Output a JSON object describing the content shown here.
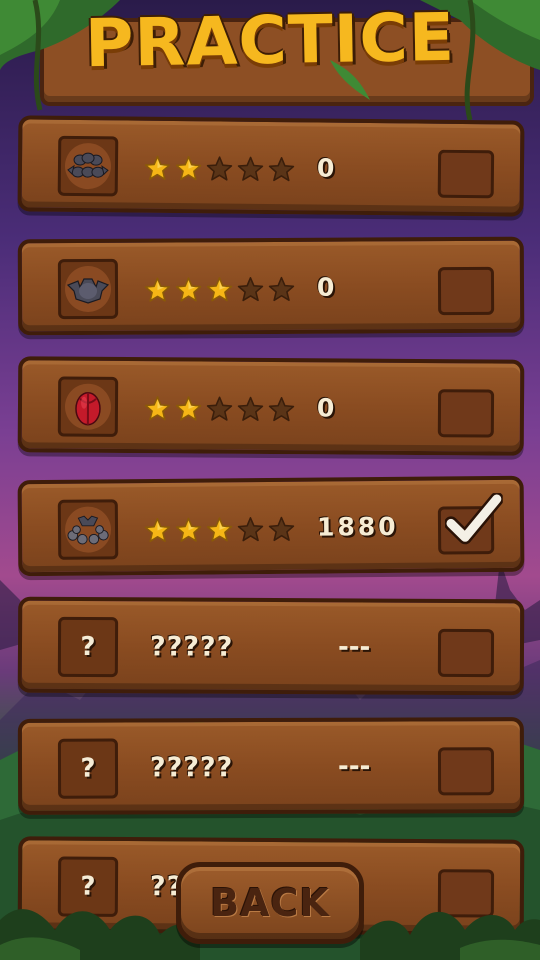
{
  "header": {
    "title": "PRACTICE"
  },
  "levels": [
    {
      "icon": "bat-swarm-icon",
      "stars_earned": 2,
      "stars_total": 5,
      "score": "0",
      "completed": false
    },
    {
      "icon": "bat-icon",
      "stars_earned": 3,
      "stars_total": 5,
      "score": "0",
      "completed": false
    },
    {
      "icon": "red-cocoon-icon",
      "stars_earned": 2,
      "stars_total": 5,
      "score": "0",
      "completed": false
    },
    {
      "icon": "bat-eggs-icon",
      "stars_earned": 3,
      "stars_total": 5,
      "score": "1880",
      "completed": true
    },
    {
      "icon": "question-mark-icon",
      "locked": true,
      "name": "?????",
      "score": "---",
      "symbol": "?",
      "completed": false
    },
    {
      "icon": "question-mark-icon",
      "locked": true,
      "name": "?????",
      "score": "---",
      "symbol": "?",
      "completed": false
    },
    {
      "icon": "question-mark-icon",
      "locked": true,
      "name": "??",
      "score": "",
      "symbol": "?",
      "completed": false
    }
  ],
  "footer": {
    "back_label": "BACK"
  },
  "colors": {
    "star_gold": "#f5b616",
    "star_empty": "#5a3417",
    "wood": "#8a4c21",
    "title_gold": "#f6b81f"
  }
}
